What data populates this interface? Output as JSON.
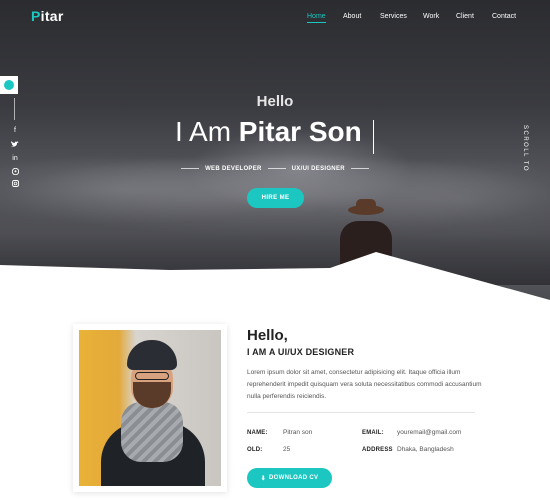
{
  "brand": {
    "logo_initial": "P",
    "logo_rest": "itar"
  },
  "nav": {
    "items": [
      "Home",
      "About",
      "Services",
      "Work",
      "Client",
      "Contact"
    ],
    "active": "Home"
  },
  "social": [
    "f",
    "t",
    "in",
    "p",
    "ig"
  ],
  "hero": {
    "greeting": "Hello",
    "title_prefix": "I Am",
    "title_name": "Pitar Son",
    "role_1": "WEB DEVELOPER",
    "role_2": "UX/UI DESIGNER",
    "cta": "HIRE ME",
    "scroll_label": "SCROLL TO"
  },
  "about": {
    "greeting": "Hello,",
    "role": "I AM A UI/UX DESIGNER",
    "text": "Lorem ipsum dolor sit amet, consectetur adipisicing elit. Itaque officia illum reprehenderit impedit quisquam vera soluta necessitatibus commodi accusantium nulla perferendis reiciendis.",
    "info": {
      "name_label": "NAME:",
      "name_value": "Pitran son",
      "email_label": "EMAIL:",
      "email_value": "youremail@gmail.com",
      "old_label": "OLD:",
      "old_value": "25",
      "address_label": "ADDRESS",
      "address_value": "Dhaka, Bangladesh"
    },
    "download": "DOWNLOAD CV"
  },
  "colors": {
    "accent": "#1cc7c1",
    "dark": "#222222"
  }
}
